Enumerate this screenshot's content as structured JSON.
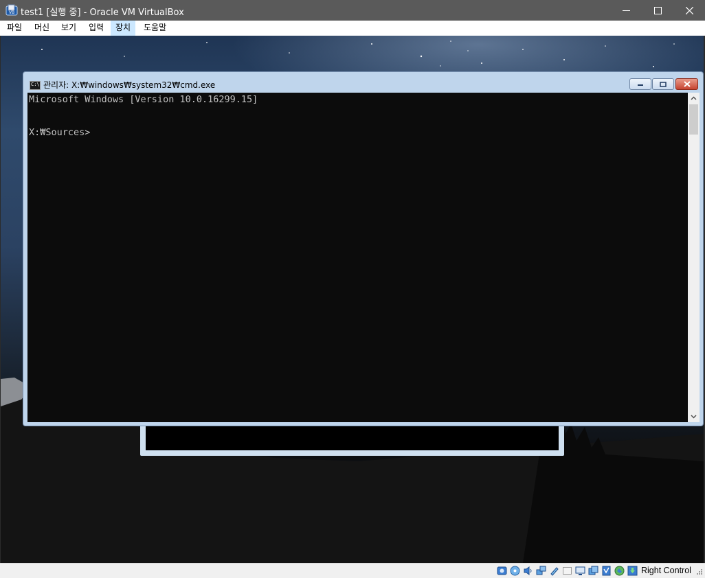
{
  "host": {
    "title": "test1 [실행 중] - Oracle VM VirtualBox",
    "icon": "virtualbox-icon",
    "menu": [
      "파일",
      "머신",
      "보기",
      "입력",
      "장치",
      "도움말"
    ],
    "active_menu": "장치"
  },
  "cmd": {
    "title": "관리자: X:₩windows₩system32₩cmd.exe",
    "icon_label": "C:\\",
    "lines": [
      "Microsoft Windows [Version 10.0.16299.15]",
      "",
      "X:₩Sources>"
    ],
    "colors": {
      "background": "#0c0c0c",
      "text": "#c0c0c0"
    }
  },
  "statusbar": {
    "icons": [
      "hard-disk-icon",
      "optical-drive-icon",
      "audio-icon",
      "network-icon",
      "usb-icon",
      "shared-folders-icon",
      "display-icon",
      "recording-icon",
      "cpu-icon",
      "guest-additions-icon",
      "mouse-integration-icon"
    ],
    "host_key": "Right Control"
  }
}
